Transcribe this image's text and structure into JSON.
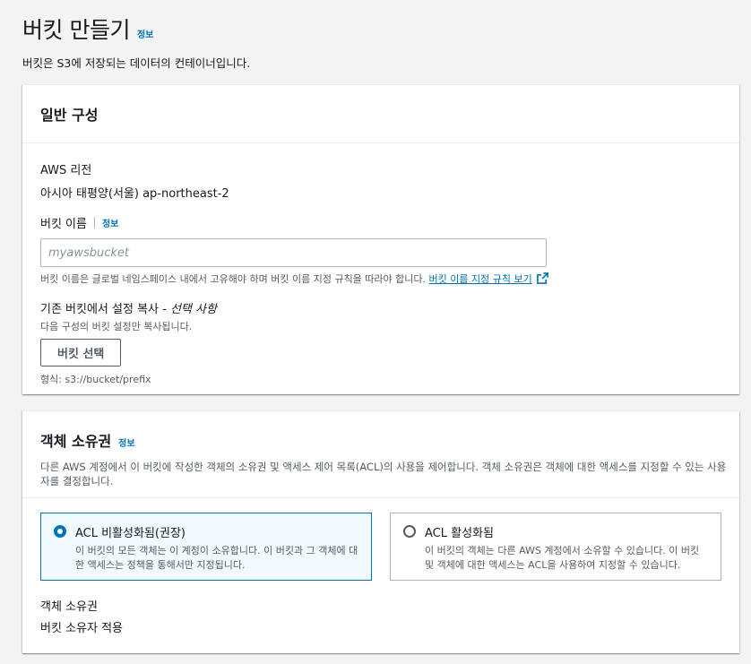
{
  "page": {
    "title": "버킷 만들기",
    "info_link": "정보",
    "description": "버킷은 S3에 저장되는 데이터의 컨테이너입니다."
  },
  "general": {
    "title": "일반 구성",
    "region_label": "AWS 리전",
    "region_value": "아시아 태평양(서울) ap-northeast-2",
    "bucket_name_label": "버킷 이름",
    "bucket_name_info": "정보",
    "bucket_name_placeholder": "myawsbucket",
    "bucket_name_hint": "버킷 이름은 글로벌 네임스페이스 내에서 고유해야 하며 버킷 이름 지정 규칙을 따라야 합니다.",
    "naming_rules_link": "버킷 이름 지정 규칙 보기",
    "copy_label": "기존 버킷에서 설정 복사 - ",
    "copy_optional": "선택 사항",
    "copy_desc": "다음 구성의 버킷 설정만 복사됩니다.",
    "choose_bucket_button": "버킷 선택",
    "format_hint": "형식: s3://bucket/prefix"
  },
  "ownership": {
    "title": "객체 소유권",
    "info_link": "정보",
    "description": "다른 AWS 계정에서 이 버킷에 작성한 객체의 소유권 및 액세스 제어 목록(ACL)의 사용을 제어합니다. 객체 소유권은 객체에 대한 액세스를 지정할 수 있는 사용자를 결정합니다.",
    "options": [
      {
        "title": "ACL 비활성화됨(권장)",
        "desc": "이 버킷의 모든 객체는 이 계정이 소유합니다. 이 버킷과 그 객체에 대한 액세스는 정책을 통해서만 지정됩니다.",
        "selected": true
      },
      {
        "title": "ACL 활성화됨",
        "desc": "이 버킷의 객체는 다른 AWS 계정에서 소유할 수 있습니다. 이 버킷 및 객체에 대한 액세스는 ACL을 사용하여 지정할 수 있습니다.",
        "selected": false
      }
    ],
    "owner_label": "객체 소유권",
    "owner_value": "버킷 소유자 적용"
  },
  "colors": {
    "accent": "#0073bb",
    "selected_bg": "#f1faff",
    "page_bg": "#f2f3f3"
  }
}
